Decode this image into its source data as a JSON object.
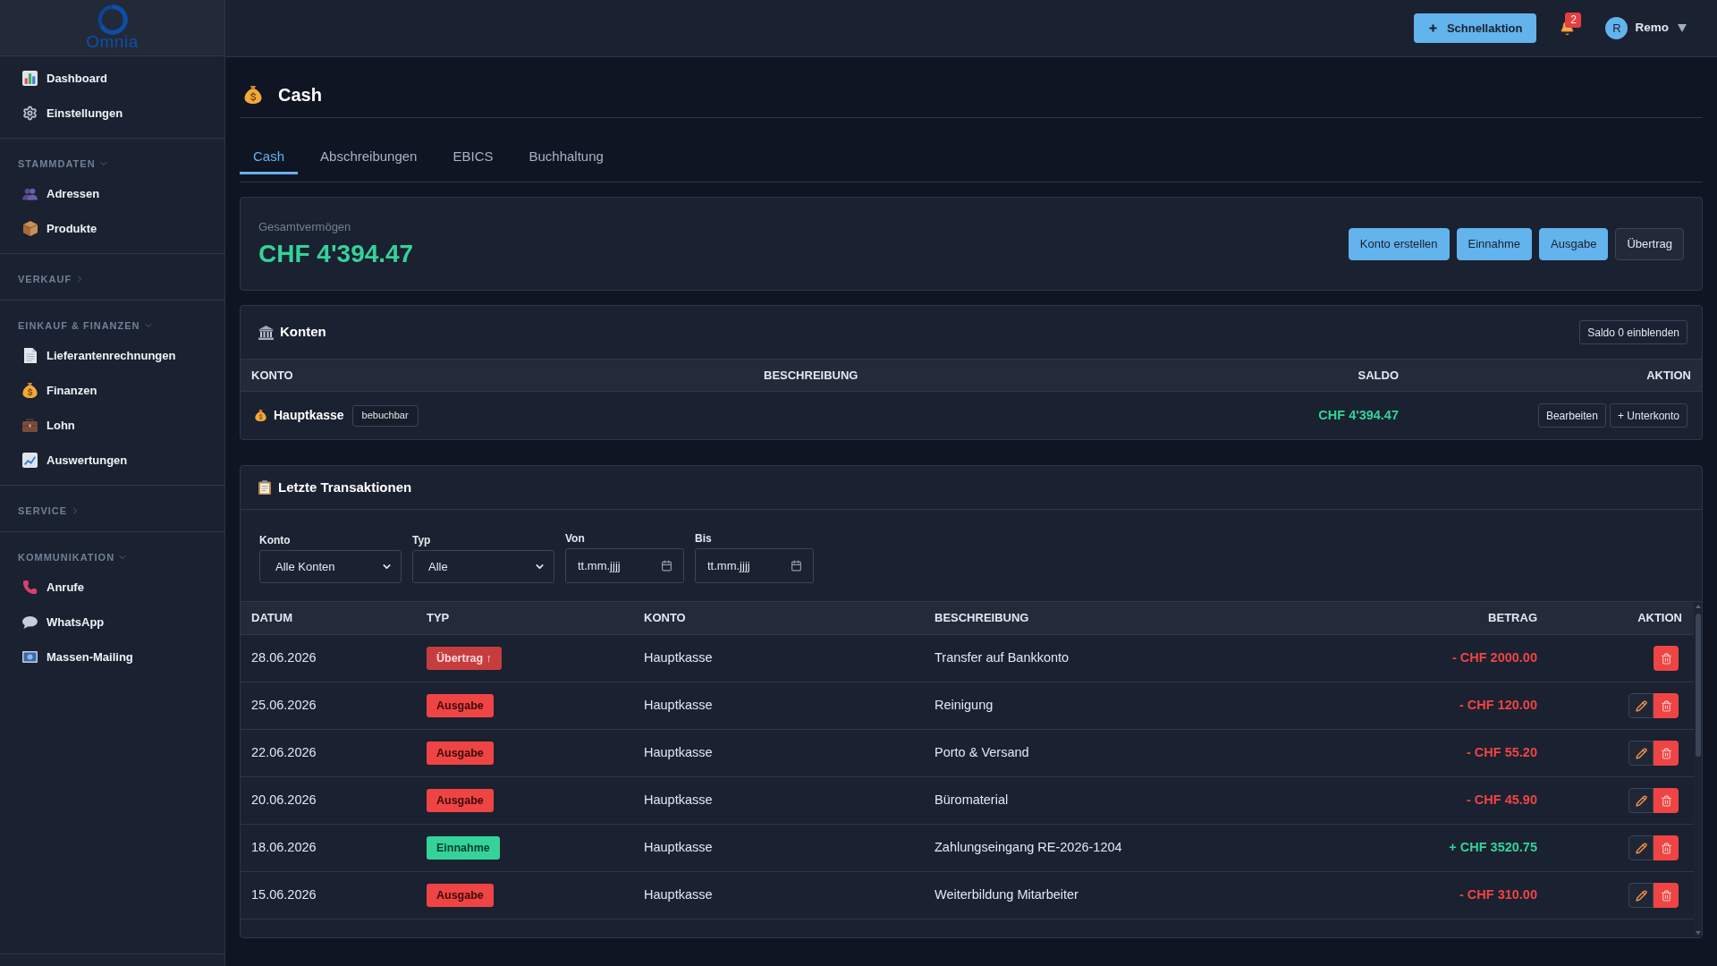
{
  "sidebar": {
    "logo": {
      "text": "Omnia"
    },
    "groups": [
      {
        "items": [
          {
            "label": "Dashboard",
            "selected": false
          },
          {
            "label": "Einstellungen",
            "selected": false
          }
        ]
      },
      {
        "title": "STAMMDATEN",
        "expanded": true,
        "items": [
          {
            "label": "Adressen",
            "selected": false
          },
          {
            "label": "Produkte",
            "selected": false
          }
        ]
      },
      {
        "title": "VERKAUF",
        "expanded": false
      },
      {
        "title": "EINKAUF & FINANZEN",
        "expanded": true,
        "items": [
          {
            "label": "Lieferantenrechnungen",
            "selected": false
          },
          {
            "label": "Finanzen",
            "selected": false
          },
          {
            "label": "Lohn",
            "selected": false
          },
          {
            "label": "Auswertungen",
            "selected": false
          }
        ]
      },
      {
        "title": "SERVICE",
        "expanded": false
      },
      {
        "title": "KOMMUNIKATION",
        "expanded": true,
        "items": [
          {
            "label": "Anrufe",
            "selected": false
          },
          {
            "label": "WhatsApp",
            "selected": false
          },
          {
            "label": "Massen-Mailing",
            "selected": false
          }
        ]
      }
    ]
  },
  "top_bar": {
    "quick_action": "Schnellaktion",
    "notifications": {
      "count": "2"
    },
    "user": {
      "initial": "R",
      "name": "Remo"
    }
  },
  "page": {
    "title": "Cash"
  },
  "tabs": [
    {
      "label": "Cash",
      "selected": true
    },
    {
      "label": "Abschreibungen",
      "selected": false
    },
    {
      "label": "EBICS",
      "selected": false
    },
    {
      "label": "Buchhaltung",
      "selected": false
    }
  ],
  "summary": {
    "label": "Gesamtvermögen",
    "total": "CHF 4'394.47",
    "buttons": [
      {
        "label": "Konto erstellen",
        "kind": "primary"
      },
      {
        "label": "Einnahme",
        "kind": "primary"
      },
      {
        "label": "Ausgabe",
        "kind": "primary"
      },
      {
        "label": "Übertrag",
        "kind": "secondary"
      }
    ]
  },
  "accounts": {
    "title": "Konten",
    "toggle_button": "Saldo 0 einblenden",
    "columns": [
      "KONTO",
      "BESCHREIBUNG",
      "SALDO",
      "AKTION"
    ],
    "rows": [
      {
        "name": "Hauptkasse",
        "badge": "bebuchbar",
        "balance": "CHF 4'394.47",
        "actions": [
          "Bearbeiten",
          "+ Unterkonto"
        ]
      }
    ]
  },
  "transactions": {
    "title": "Letzte Transaktionen",
    "filters": [
      {
        "kind": "select",
        "label": "Konto",
        "value": "Alle Konten"
      },
      {
        "kind": "select",
        "label": "Typ",
        "value": "Alle"
      },
      {
        "kind": "date",
        "label": "Von",
        "placeholder": "tt.mm.jjjj"
      },
      {
        "kind": "date",
        "label": "Bis",
        "placeholder": "tt.mm.jjjj"
      }
    ],
    "columns": [
      "DATUM",
      "TYP",
      "KONTO",
      "BESCHREIBUNG",
      "BETRAG",
      "AKTION"
    ],
    "rows": [
      {
        "date": "28.06.2026",
        "type": {
          "label": "Übertrag ↑",
          "kind": "transfer"
        },
        "account": "Hauptkasse",
        "description": "Transfer auf Bankkonto",
        "amount": "- CHF 2000.00",
        "actions": [
          {
            "kind": "delete"
          }
        ]
      },
      {
        "date": "25.06.2026",
        "type": {
          "label": "Ausgabe",
          "kind": "expense"
        },
        "account": "Hauptkasse",
        "description": "Reinigung",
        "amount": "- CHF 120.00",
        "actions": [
          {
            "kind": "edit"
          },
          {
            "kind": "delete"
          }
        ]
      },
      {
        "date": "22.06.2026",
        "type": {
          "label": "Ausgabe",
          "kind": "expense"
        },
        "account": "Hauptkasse",
        "description": "Porto & Versand",
        "amount": "- CHF 55.20",
        "actions": [
          {
            "kind": "edit"
          },
          {
            "kind": "delete"
          }
        ]
      },
      {
        "date": "20.06.2026",
        "type": {
          "label": "Ausgabe",
          "kind": "expense"
        },
        "account": "Hauptkasse",
        "description": "Büromaterial",
        "amount": "- CHF 45.90",
        "actions": [
          {
            "kind": "edit"
          },
          {
            "kind": "delete"
          }
        ]
      },
      {
        "date": "18.06.2026",
        "type": {
          "label": "Einnahme",
          "kind": "income"
        },
        "account": "Hauptkasse",
        "description": "Zahlungseingang RE-2026-1204",
        "amount": "+ CHF 3520.75",
        "actions": [
          {
            "kind": "edit"
          },
          {
            "kind": "delete"
          }
        ]
      },
      {
        "date": "15.06.2026",
        "type": {
          "label": "Ausgabe",
          "kind": "expense"
        },
        "account": "Hauptkasse",
        "description": "Weiterbildung Mitarbeiter",
        "amount": "- CHF 310.00",
        "actions": [
          {
            "kind": "edit"
          },
          {
            "kind": "delete"
          }
        ]
      }
    ]
  }
}
